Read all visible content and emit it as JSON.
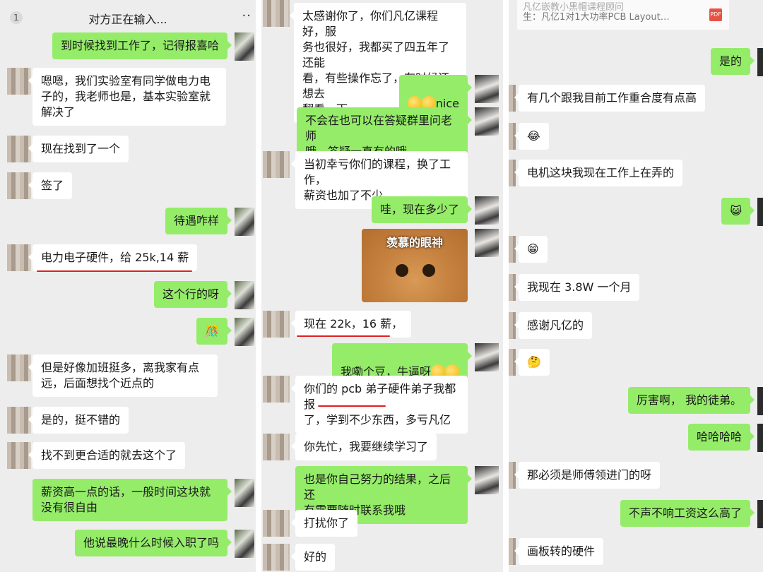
{
  "panel1": {
    "header": {
      "badge": "1",
      "title": "对方正在输入...",
      "more": "··"
    },
    "messages": [
      {
        "text": "到时候找到工作了，记得报喜哈"
      },
      {
        "text": "嗯嗯，我们实验室有同学做电力电\n子的，我老师也是，基本实验室就\n解决了"
      },
      {
        "text": "现在找到了一个"
      },
      {
        "text": "签了"
      },
      {
        "text": "待遇咋样"
      },
      {
        "text": "电力电子硬件，给 25k,14 薪"
      },
      {
        "text": "这个行的呀"
      },
      {
        "text": "🎊"
      },
      {
        "text": "但是好像加班挺多，离我家有点\n远，后面想找个近点的"
      },
      {
        "text": "是的，挺不错的"
      },
      {
        "text": "找不到更合适的就去这个了"
      },
      {
        "text": "薪资高一点的话，一般时间这块就\n没有很自由"
      },
      {
        "text": "他说最晚什么时候入职了吗"
      }
    ]
  },
  "panel2": {
    "messages": [
      {
        "text": "太感谢你了，你们凡亿课程好，服\n务也很好，我都买了四五年了还能\n看，有些操作忘了，有时候还想去\n翻看一下"
      },
      {
        "text": "nice"
      },
      {
        "text": "不会在也可以在答疑群里问老师\n哦，答疑一直有的哦"
      },
      {
        "text": "当初幸亏你们的课程，换了工作，\n薪资也加了不少"
      },
      {
        "text": "哇，现在多少了"
      },
      {
        "text": "现在 22k，16 薪，"
      },
      {
        "text": "我嘞个豆，牛逼呀"
      },
      {
        "text": "你们的 pcb 弟子硬件弟子我都报\n了，学到不少东西，多亏凡亿"
      },
      {
        "text": "你先忙，我要继续学习了"
      },
      {
        "text": "也是你自己努力的结果，之后还\n有需要随时联系我哦"
      },
      {
        "text": "打扰你了"
      },
      {
        "text": "好的"
      }
    ],
    "sticker_caption": "羡慕的眼神"
  },
  "panel3": {
    "file": {
      "line1": "凡亿嵌教小黑帽课程顾问",
      "line2": "生：凡亿1对1大功率PCB Layout…",
      "icon": "PDF"
    },
    "messages": [
      {
        "text": "是的"
      },
      {
        "text": "有几个跟我目前工作重合度有点高"
      },
      {
        "text": "😂"
      },
      {
        "text": "电机这块我现在工作上在弄的"
      },
      {
        "text": "😺"
      },
      {
        "text": "😁"
      },
      {
        "text": "我现在 3.8W 一个月"
      },
      {
        "text": "感谢凡亿的"
      },
      {
        "text": "🤔"
      },
      {
        "text": "厉害啊， 我的徒弟。"
      },
      {
        "text": "哈哈哈哈"
      },
      {
        "text": "那必须是师傅领进门的呀"
      },
      {
        "text": "不声不响工资这么高了"
      },
      {
        "text": "画板转的硬件"
      }
    ]
  }
}
